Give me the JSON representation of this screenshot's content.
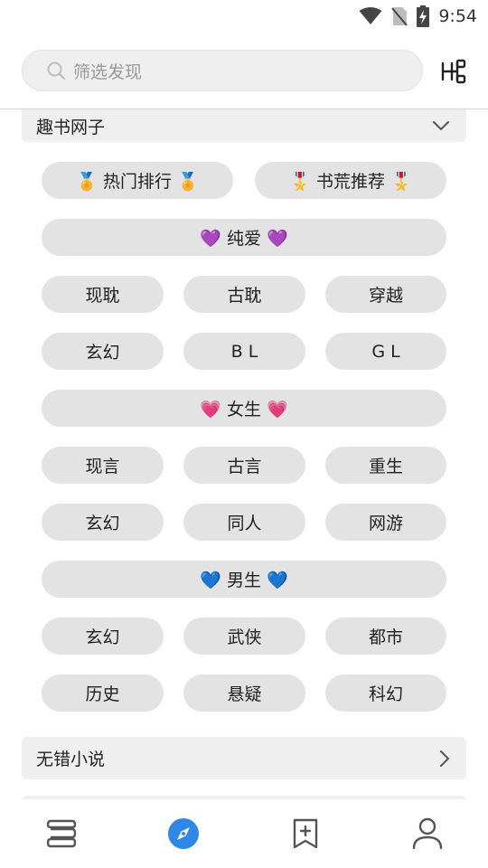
{
  "status_bar": {
    "time": "9:54"
  },
  "search": {
    "placeholder": "筛选发现"
  },
  "sections": [
    {
      "title": "趣书网子",
      "rows": [
        [
          "🏅 热门排行 🏅",
          "🎖️ 书荒推荐 🎖️"
        ],
        [
          "💜 纯爱 💜"
        ],
        [
          "现耽",
          "古耽",
          "穿越"
        ],
        [
          "玄幻",
          "B L",
          "G L"
        ],
        [
          "💗 女生 💗"
        ],
        [
          "现言",
          "古言",
          "重生"
        ],
        [
          "玄幻",
          "同人",
          "网游"
        ],
        [
          "💙 男生 💙"
        ],
        [
          "玄幻",
          "武侠",
          "都市"
        ],
        [
          "历史",
          "悬疑",
          "科幻"
        ]
      ]
    },
    {
      "title": "无错小说"
    }
  ],
  "colors": {
    "accent": "#2f88e6",
    "pill_bg": "#e3e3e3",
    "section_bg": "#efefef"
  },
  "bottom_nav": [
    {
      "name": "bookshelf-icon"
    },
    {
      "name": "discover-compass-icon",
      "active": true
    },
    {
      "name": "bookmark-add-icon"
    },
    {
      "name": "profile-icon"
    }
  ]
}
